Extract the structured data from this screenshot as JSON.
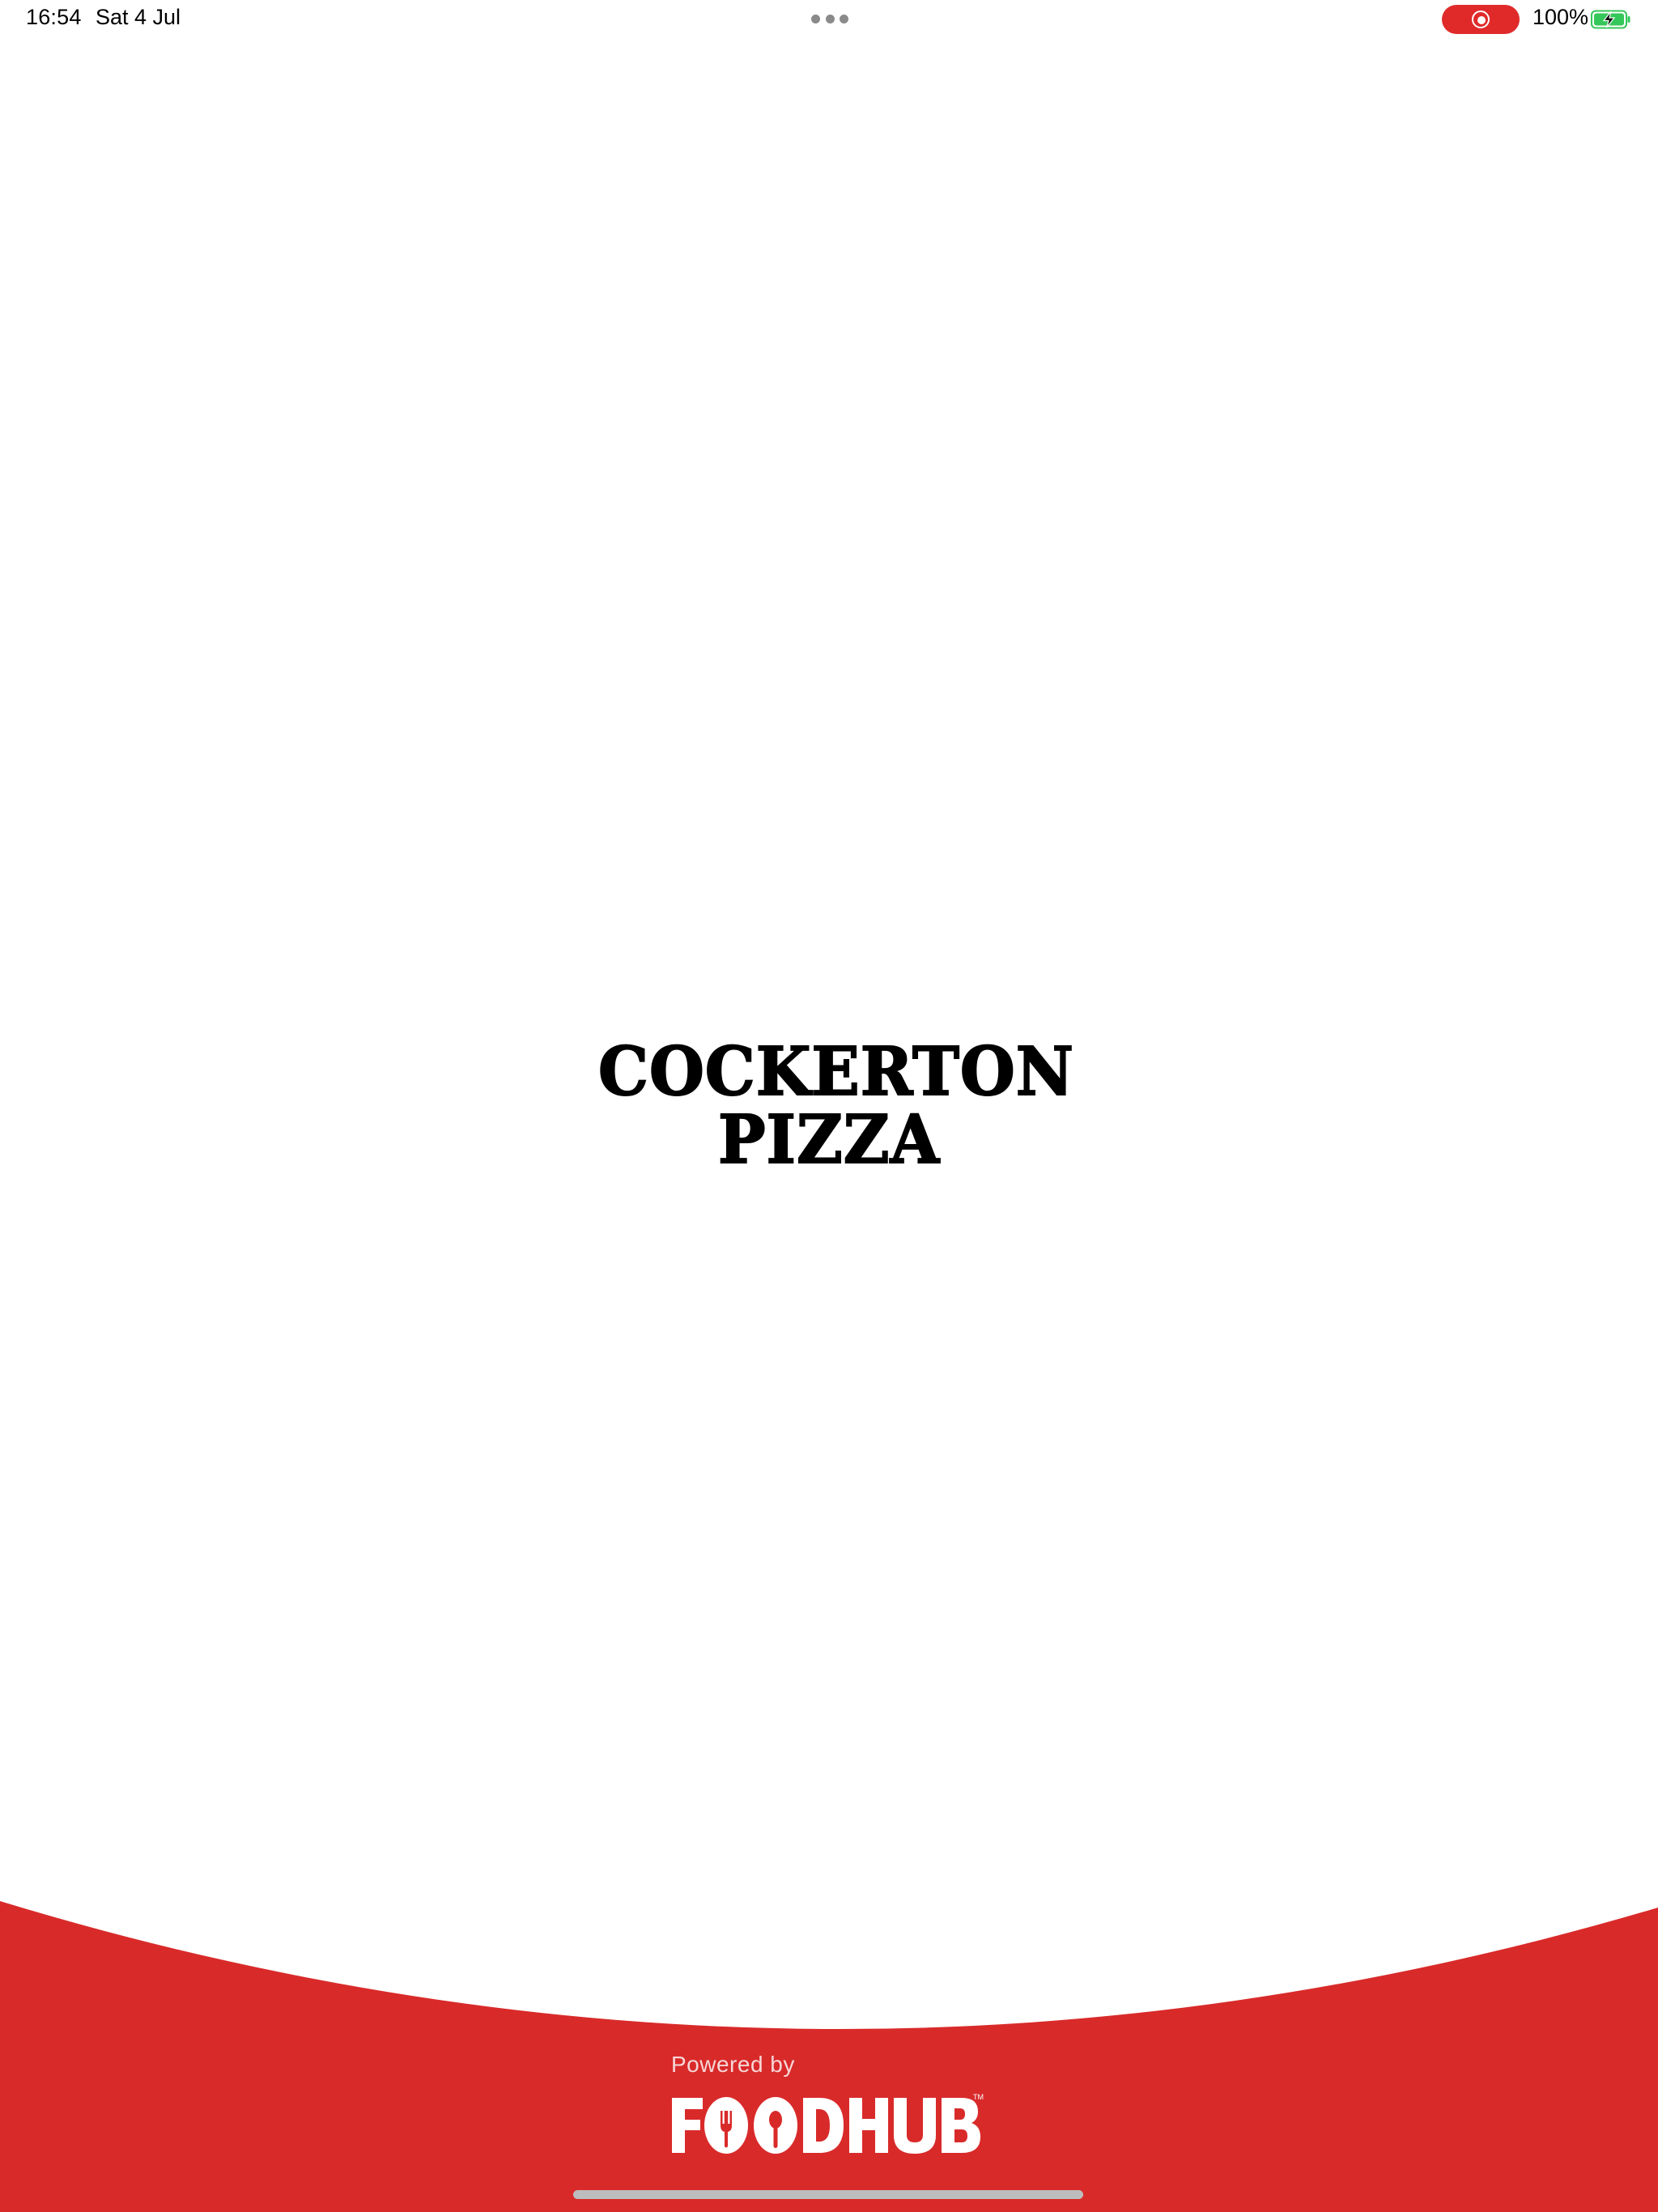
{
  "status_bar": {
    "time": "16:54",
    "date": "Sat 4 Jul",
    "battery_percent": "100%",
    "battery_level": 1.0,
    "recording_indicator_color": "#e02a2a",
    "charging_color": "#34c759"
  },
  "splash": {
    "brand_line_1": "COCKERTON",
    "brand_line_2": "PIZZA",
    "powered_by": "Powered by",
    "provider_logo": "FOODHUB",
    "provider_trademark": "TM",
    "footer_color": "#d92a2a",
    "background_color": "#ffffff"
  }
}
